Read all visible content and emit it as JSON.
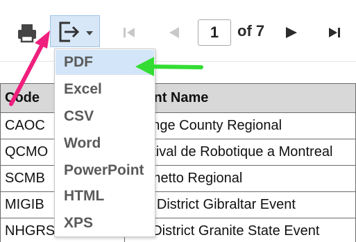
{
  "toolbar": {
    "page_number": "1",
    "page_of": "of 7"
  },
  "export_menu": {
    "items": [
      {
        "label": "PDF",
        "active": true
      },
      {
        "label": "Excel"
      },
      {
        "label": "CSV"
      },
      {
        "label": "Word"
      },
      {
        "label": "PowerPoint"
      },
      {
        "label": "HTML"
      },
      {
        "label": "XPS"
      }
    ]
  },
  "table": {
    "headers": [
      "Code",
      "Event Name"
    ],
    "rows": [
      [
        "CAOC",
        "Orange County Regional"
      ],
      [
        "QCMO",
        "Festival de Robotique a Montreal"
      ],
      [
        "SCMB",
        "Palmetto Regional"
      ],
      [
        "MIGIB",
        "FIM District Gibraltar Event"
      ],
      [
        "NHGRS",
        "NE District Granite State Event"
      ]
    ]
  },
  "colors": {
    "accent_pink": "#ee1f7d",
    "accent_green": "#33dd33",
    "selected_bg": "#d3e5f8"
  },
  "icons": [
    "printer-icon",
    "export-icon",
    "chevron-down-icon",
    "first-page-icon",
    "previous-page-icon",
    "next-page-icon",
    "last-page-icon"
  ]
}
